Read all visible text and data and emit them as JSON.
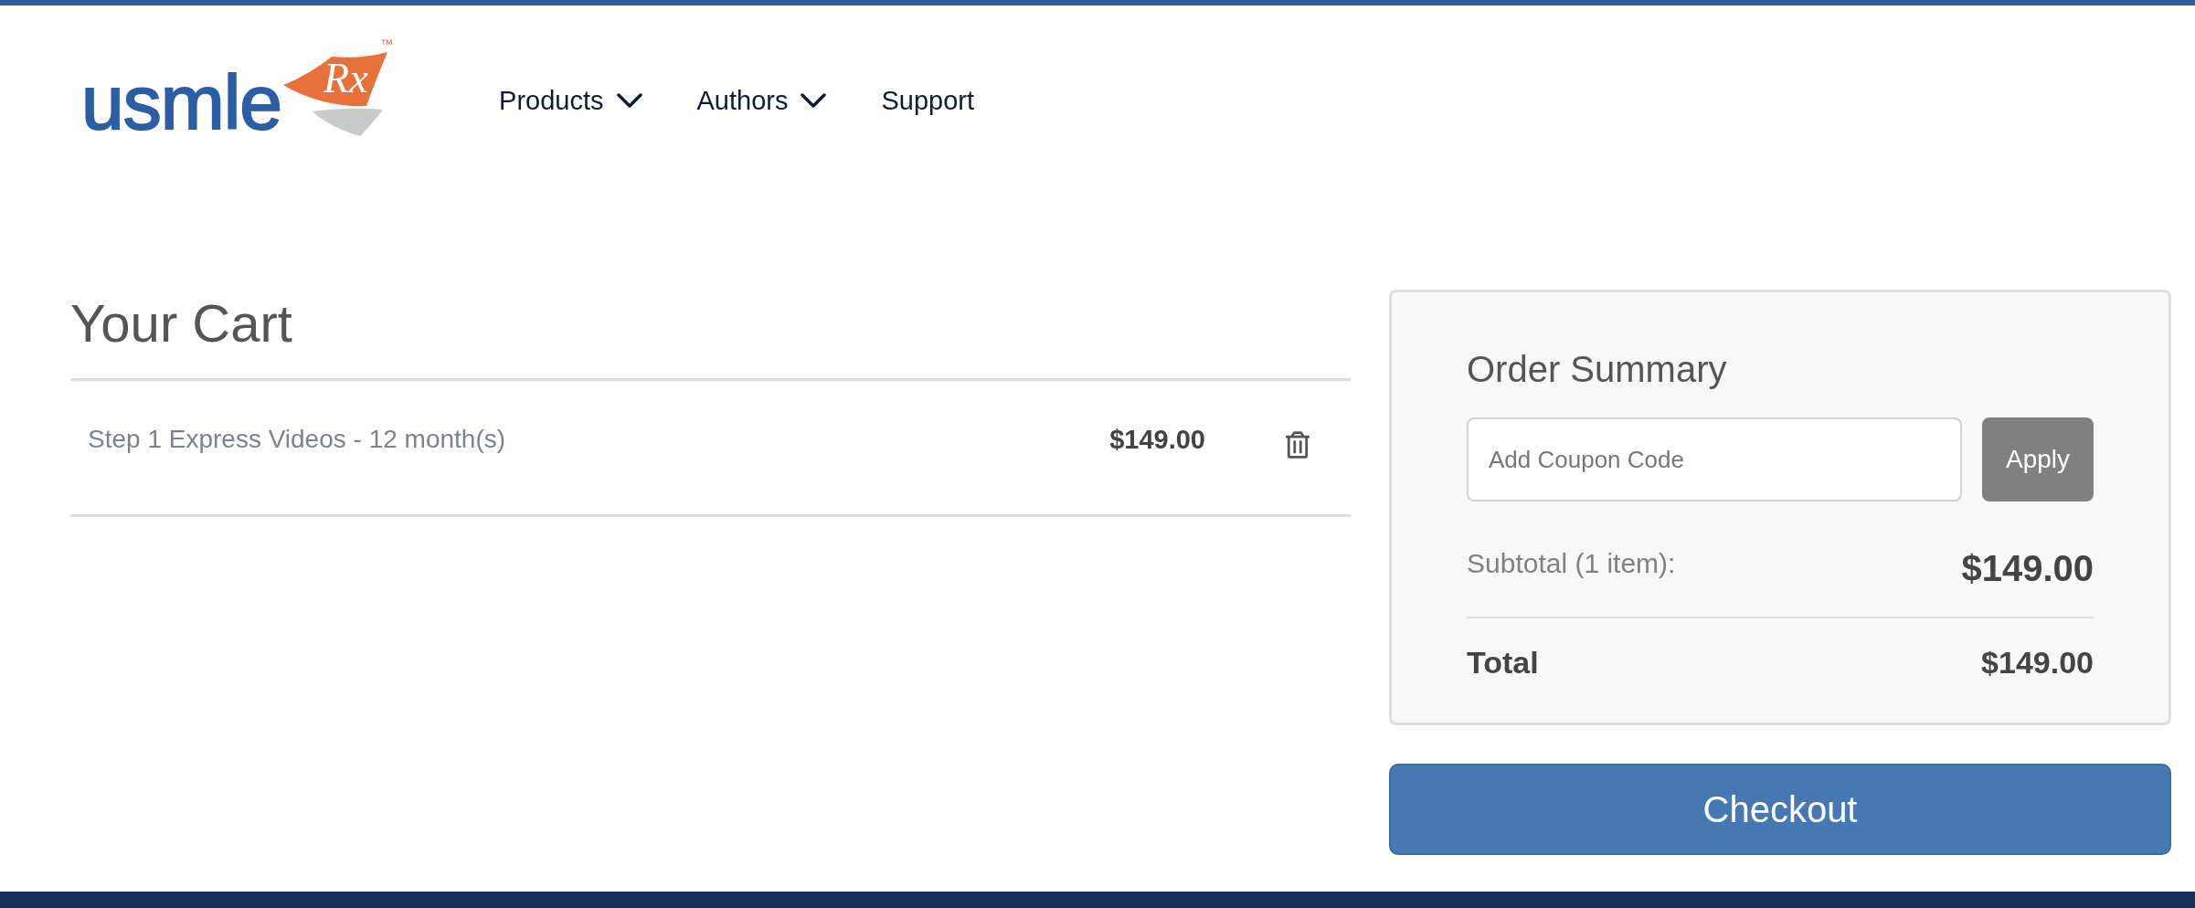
{
  "header": {
    "logo": {
      "wordmark": "usmle",
      "mark": "Rx",
      "trademark": "™"
    },
    "nav": [
      {
        "label": "Products",
        "kind": "dropdown"
      },
      {
        "label": "Authors",
        "kind": "dropdown"
      },
      {
        "label": "Support",
        "kind": "link"
      }
    ]
  },
  "cart": {
    "title": "Your Cart",
    "items": [
      {
        "name": "Step 1 Express Videos - 12 month(s)",
        "price": "$149.00"
      }
    ]
  },
  "order_summary": {
    "title": "Order Summary",
    "coupon": {
      "placeholder": "Add Coupon Code",
      "button": "Apply"
    },
    "subtotal": {
      "label": "Subtotal (1 item):",
      "value": "$149.00"
    },
    "total": {
      "label": "Total",
      "value": "$149.00"
    }
  },
  "checkout_button": "Checkout"
}
